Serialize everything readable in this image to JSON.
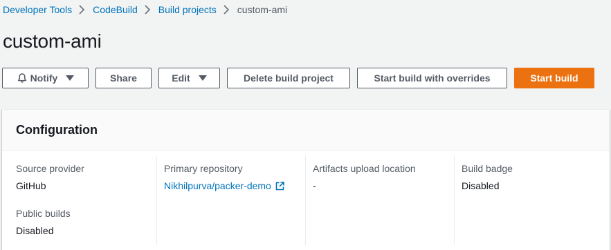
{
  "breadcrumb": {
    "items": [
      "Developer Tools",
      "CodeBuild",
      "Build projects"
    ],
    "current": "custom-ami"
  },
  "page": {
    "title": "custom-ami"
  },
  "toolbar": {
    "notify_label": "Notify",
    "share_label": "Share",
    "edit_label": "Edit",
    "delete_label": "Delete build project",
    "start_overrides_label": "Start build with overrides",
    "start_build_label": "Start build"
  },
  "configuration": {
    "title": "Configuration",
    "source_provider": {
      "label": "Source provider",
      "value": "GitHub"
    },
    "public_builds": {
      "label": "Public builds",
      "value": "Disabled"
    },
    "primary_repository": {
      "label": "Primary repository",
      "value": "Nikhilpurva/packer-demo"
    },
    "artifacts_upload_location": {
      "label": "Artifacts upload location",
      "value": "-"
    },
    "build_badge": {
      "label": "Build badge",
      "value": "Disabled"
    }
  },
  "colors": {
    "accent_link": "#0073bb",
    "primary_button": "#ec7211",
    "page_background": "#f2f3f3"
  },
  "icons": [
    "chevron-right-icon",
    "bell-icon",
    "caret-down-icon",
    "external-link-icon"
  ]
}
